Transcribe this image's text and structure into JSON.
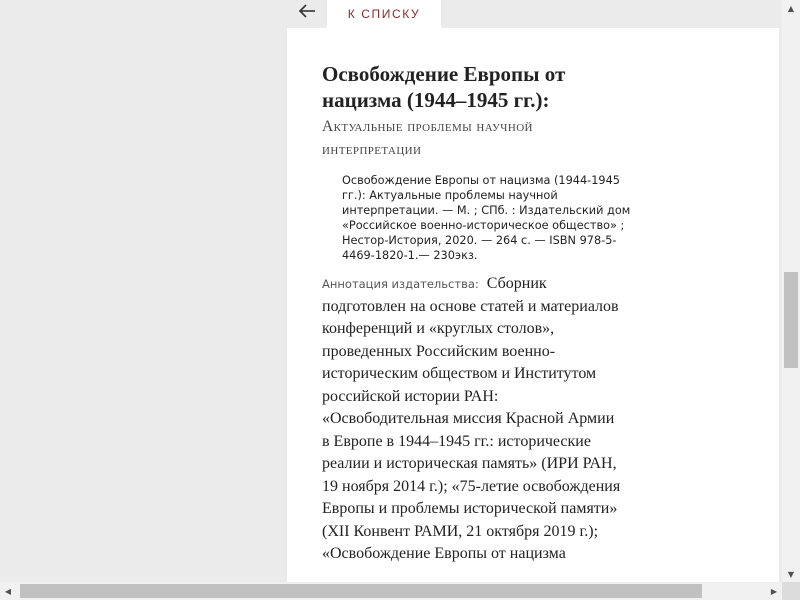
{
  "nav": {
    "back_icon": "arrow-left-icon",
    "to_list_label": "К СПИСКУ"
  },
  "book": {
    "title": "Освобождение Европы от нацизма (1944–1945 гг.):",
    "subtitle": "Актуальные проблемы научной интерпретации",
    "bibliographic_record": "Освобождение Европы от нацизма (1944-1945 гг.): Актуальные проблемы научной интерпретации. — М. ; СПб. : Издательский дом «Российское военно-историческое общество» ; Нестор-История, 2020. — 264 с. — ISBN 978-5-4469-1820-1.— 230экз.",
    "annotation_label": "Аннотация издательства:",
    "annotation_text": "Сборник подготовлен на основе статей и материалов конференций и «круглых столов», проведенных Российским военно-историческим обществом и Институтом российской истории РАН: «Освободительная миссия Красной Армии в Европе в 1944–1945 гг.: исторические реалии и историческая память» (ИРИ РАН, 19 ноября 2014 г.); «75-летие освобождения Европы и проблемы исторической памяти» (XII Конвент РАМИ, 21 октября 2019 г.); «Освобождение Европы от нацизма"
  },
  "colors": {
    "accent": "#8b2b2b",
    "background": "#ebebeb",
    "card": "#ffffff"
  }
}
